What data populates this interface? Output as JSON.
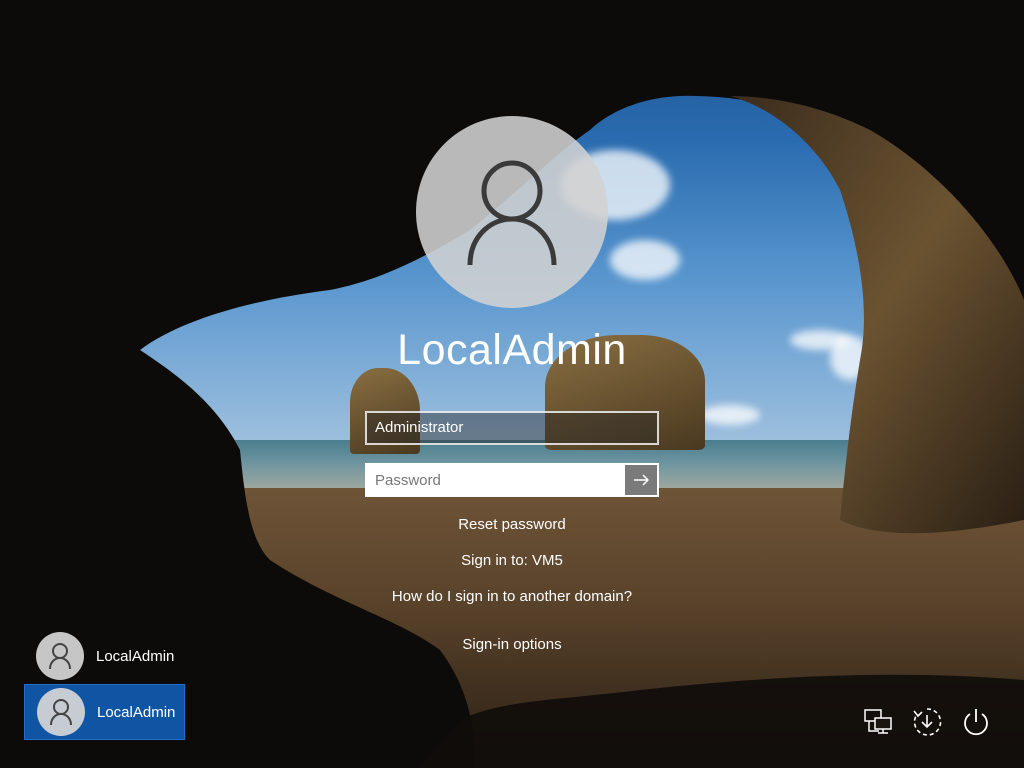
{
  "login": {
    "username": "LocalAdmin",
    "user_field_value": "Administrator",
    "password_placeholder": "Password",
    "reset_password": "Reset password",
    "sign_in_to": "Sign in to: VM5",
    "other_domain": "How do I sign in to another domain?",
    "sign_in_options": "Sign-in options"
  },
  "users": [
    {
      "name": "LocalAdmin",
      "selected": false
    },
    {
      "name": "LocalAdmin",
      "selected": true
    }
  ],
  "tray": {
    "icons": [
      "network-icon",
      "ease-of-access-icon",
      "power-icon"
    ]
  },
  "colors": {
    "selected_tile": "#0f55a3",
    "submit_button": "#7a7a7a"
  }
}
